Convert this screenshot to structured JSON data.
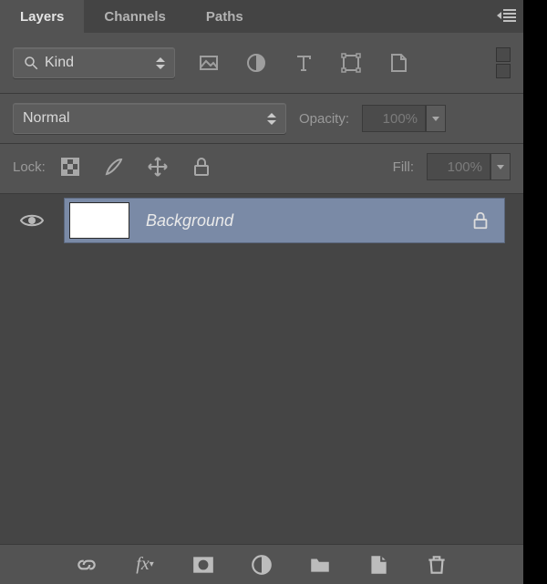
{
  "tabs": {
    "layers": "Layers",
    "channels": "Channels",
    "paths": "Paths"
  },
  "filter": {
    "kindLabel": "Kind",
    "icons": {
      "pixel": "pixel-layer-filter",
      "adjust": "adjustment-layer-filter",
      "type": "type-layer-filter",
      "shape": "shape-layer-filter",
      "smart": "smart-object-filter"
    }
  },
  "blend": {
    "mode": "Normal",
    "opacityLabel": "Opacity:",
    "opacityValue": "100%"
  },
  "lock": {
    "label": "Lock:",
    "fillLabel": "Fill:",
    "fillValue": "100%"
  },
  "layers": [
    {
      "name": "Background",
      "locked": true,
      "visible": true
    }
  ],
  "footer": {
    "link": "link-layers",
    "fx": "layer-effects",
    "mask": "add-mask",
    "adjust": "new-adjustment-layer",
    "group": "new-group",
    "new": "new-layer",
    "trash": "delete-layer"
  }
}
